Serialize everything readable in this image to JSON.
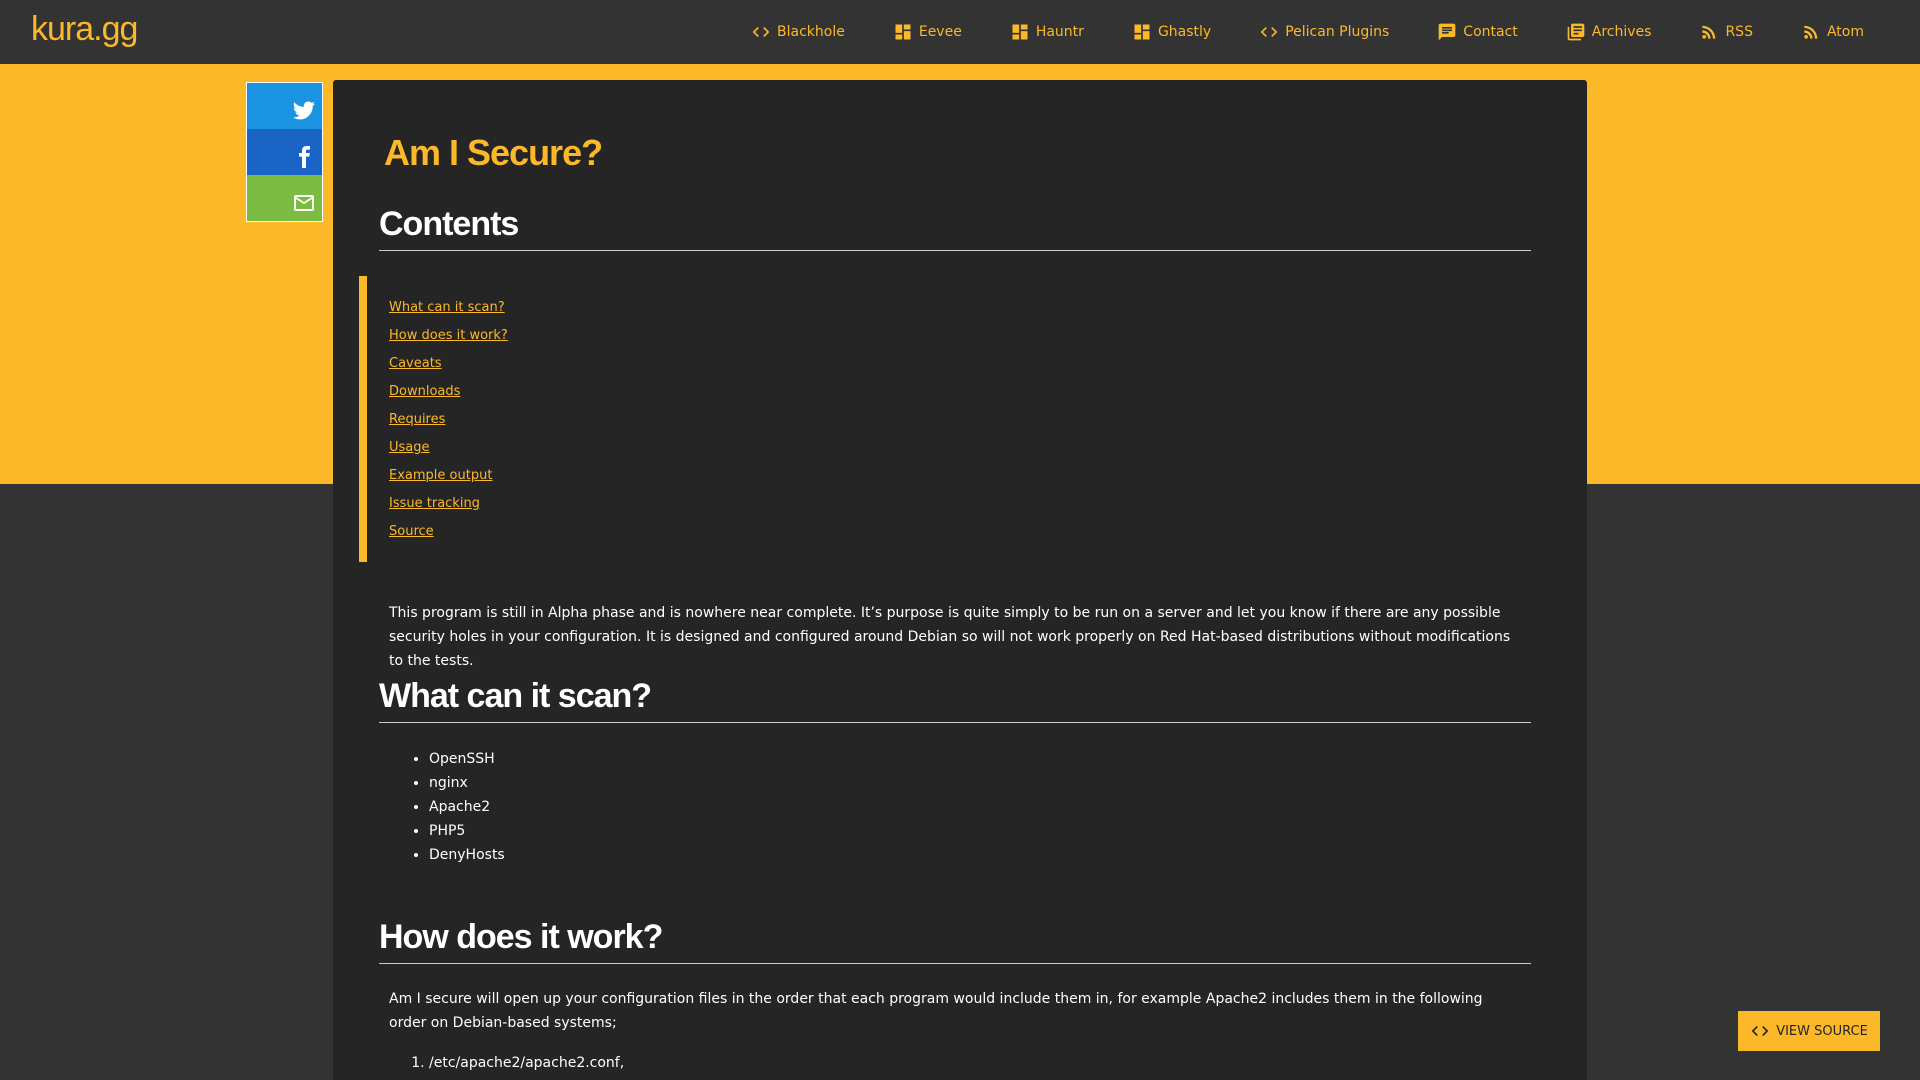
{
  "brand": "kura.gg",
  "nav": [
    {
      "label": "Blackhole",
      "icon": "code-icon"
    },
    {
      "label": "Eevee",
      "icon": "dashboard-icon"
    },
    {
      "label": "Hauntr",
      "icon": "dashboard-icon"
    },
    {
      "label": "Ghastly",
      "icon": "dashboard-icon"
    },
    {
      "label": "Pelican Plugins",
      "icon": "code-icon"
    },
    {
      "label": "Contact",
      "icon": "chat-icon"
    },
    {
      "label": "Archives",
      "icon": "library-icon"
    },
    {
      "label": "RSS",
      "icon": "rss-icon"
    },
    {
      "label": "Atom",
      "icon": "rss-icon"
    }
  ],
  "share": {
    "twitter_icon": "twitter-icon",
    "facebook_icon": "facebook-icon",
    "email_icon": "mail-icon"
  },
  "article": {
    "title": "Am I Secure?",
    "contents_heading": "Contents",
    "toc": [
      "What can it scan?",
      "How does it work?",
      "Caveats",
      "Downloads",
      "Requires",
      "Usage",
      "Example output",
      "Issue tracking",
      "Source"
    ],
    "intro": "This program is still in Alpha phase and is nowhere near complete. It’s purpose is quite simply to be run on a server and let you know if there are any possible security holes in your configuration. It is designed and configured around Debian so will not work properly on Red Hat-based distributions without modifications to the tests.",
    "scan_heading": "What can it scan?",
    "scan_items": [
      "OpenSSH",
      "nginx",
      "Apache2",
      "PHP5",
      "DenyHosts"
    ],
    "how_heading": "How does it work?",
    "how_para": "Am I secure will open up your configuration files in the order that each program would include them in, for example Apache2 includes them in the following order on Debian-based systems;",
    "how_items": [
      "/etc/apache2/apache2.conf,"
    ]
  },
  "view_source_label": "VIEW SOURCE",
  "colors": {
    "accent": "#fbb92a",
    "background": "#333333",
    "card": "#252525",
    "twitter": "#1a94e0",
    "facebook": "#1a64c6",
    "email": "#7cbc43"
  }
}
